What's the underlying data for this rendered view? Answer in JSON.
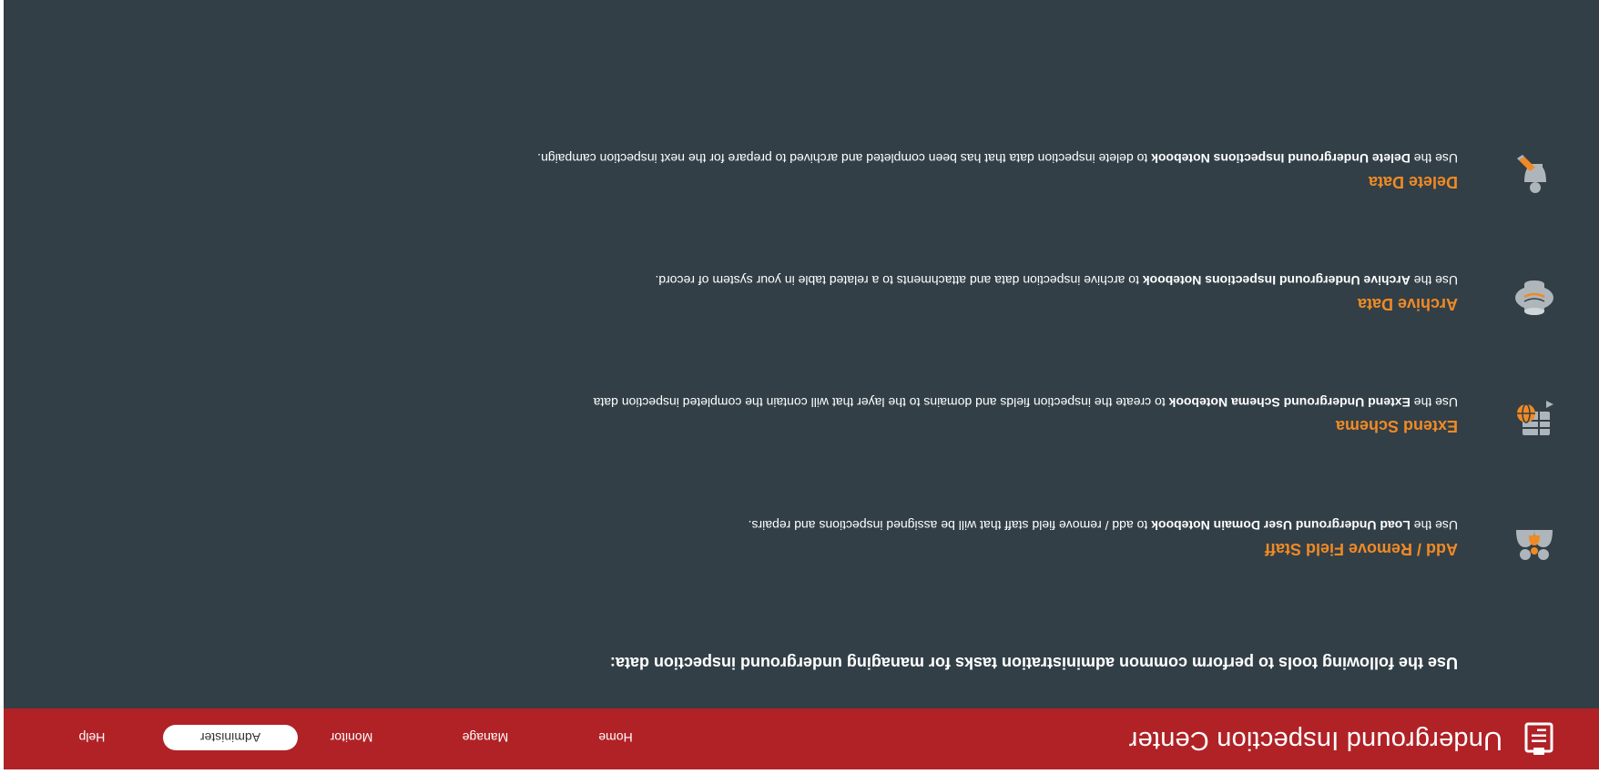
{
  "header": {
    "title": "Underground Inspection Center",
    "logo_icon": "clipboard-icon"
  },
  "nav": {
    "items": [
      {
        "label": "Home",
        "active": false
      },
      {
        "label": "Manage",
        "active": false
      },
      {
        "label": "Monitor",
        "active": false
      },
      {
        "label": "Administer",
        "active": true
      },
      {
        "label": "Help",
        "active": false
      }
    ]
  },
  "main": {
    "intro": "Use the following tools to perform common administration tasks for managing underground inspection data:",
    "tools": [
      {
        "icon": "people-icon",
        "title": "Add / Remove Field Staff",
        "desc_pre": "Use the ",
        "desc_bold": "Load Underground User Domain Notebook",
        "desc_post": " to add / remove field staff that will be assigned inspections and repairs."
      },
      {
        "icon": "table-globe-icon",
        "title": "Extend Schema",
        "desc_pre": "Use the ",
        "desc_bold": "Extend Underground Schema Notebook",
        "desc_post": " to create the inspection fields and domains to the layer that will contain the completed inspection data"
      },
      {
        "icon": "database-icon",
        "title": "Archive Data",
        "desc_pre": "Use the ",
        "desc_bold": "Archive Underground Inspections Notebook",
        "desc_post": " to archive inspection data and attachments to a related table in your system of record."
      },
      {
        "icon": "eraser-icon",
        "title": "Delete Data",
        "desc_pre": "Use the ",
        "desc_bold": "Delete Underground Inspections Notebook",
        "desc_post": " to delete inspection data that has been completed and archived to prepare for the next inspection campaign."
      }
    ]
  },
  "colors": {
    "brand_red": "#b02226",
    "background": "#323f47",
    "accent_orange": "#f08a24",
    "icon_gray": "#aeb6bb"
  }
}
